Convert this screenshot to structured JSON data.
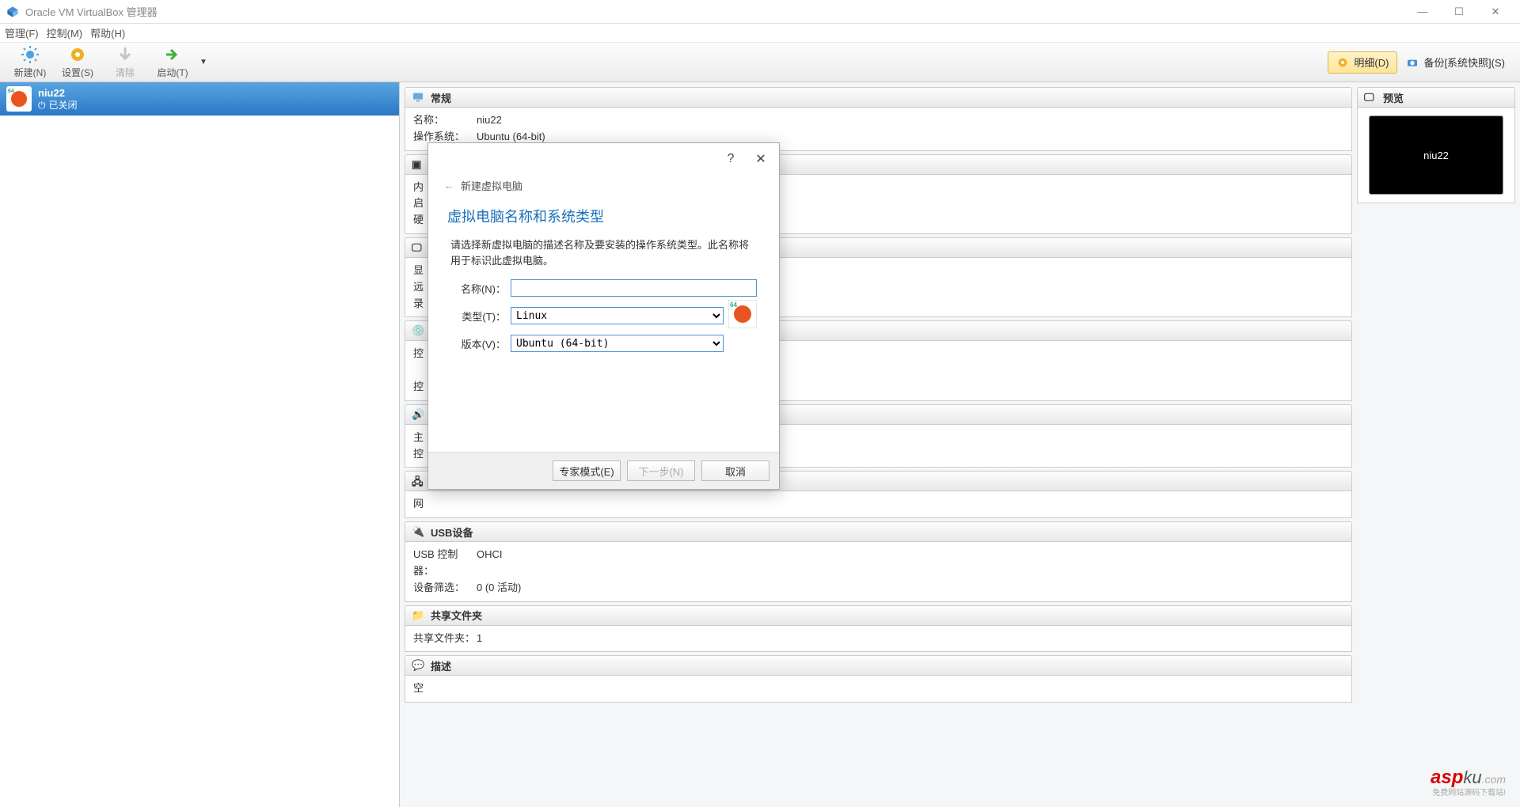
{
  "window": {
    "title": "Oracle VM VirtualBox 管理器"
  },
  "menu": {
    "file": "管理(F)",
    "control": "控制(M)",
    "help": "帮助(H)"
  },
  "toolbar": {
    "new": "新建(N)",
    "settings": "设置(S)",
    "discard": "清除",
    "start": "启动(T)",
    "details": "明细(D)",
    "snapshots": "备份[系统快照](S)"
  },
  "vm": {
    "name": "niu22",
    "state": "已关闭"
  },
  "sections": {
    "general": {
      "title": "常规",
      "name_k": "名称：",
      "name_v": "niu22",
      "os_k": "操作系统：",
      "os_v": "Ubuntu (64-bit)"
    },
    "system": {
      "mem": "内",
      "boot": "启",
      "hw": "硬"
    },
    "display": {
      "vram": "显",
      "remote": "远",
      "rec": "录"
    },
    "storage": {
      "ctrl": "控",
      "ctrl2": "控"
    },
    "audio": {
      "host": "主",
      "ctrl": "控"
    },
    "network": {
      "adapter": "网"
    },
    "usb": {
      "title": "USB设备",
      "ctrl_k": "USB 控制器：",
      "ctrl_v": "OHCI",
      "filter_k": "设备筛选：",
      "filter_v": "0 (0 活动)"
    },
    "shared": {
      "title": "共享文件夹",
      "k": "共享文件夹：",
      "v": "1"
    },
    "desc": {
      "title": "描述",
      "v": "空"
    },
    "preview": {
      "title": "预览",
      "name": "niu22"
    }
  },
  "dialog": {
    "breadcrumb": "新建虚拟电脑",
    "heading": "虚拟电脑名称和系统类型",
    "desc": "请选择新虚拟电脑的描述名称及要安装的操作系统类型。此名称将用于标识此虚拟电脑。",
    "name_label": "名称(N)：",
    "name_value": "",
    "type_label": "类型(T)：",
    "type_value": "Linux",
    "version_label": "版本(V)：",
    "version_value": "Ubuntu (64-bit)",
    "expert_btn": "专家模式(E)",
    "next_btn": "下一步(N)",
    "cancel_btn": "取消"
  },
  "watermark": {
    "a": "asp",
    "b": "ku",
    "c": ".com",
    "d": "免费网站源码下载站!"
  }
}
